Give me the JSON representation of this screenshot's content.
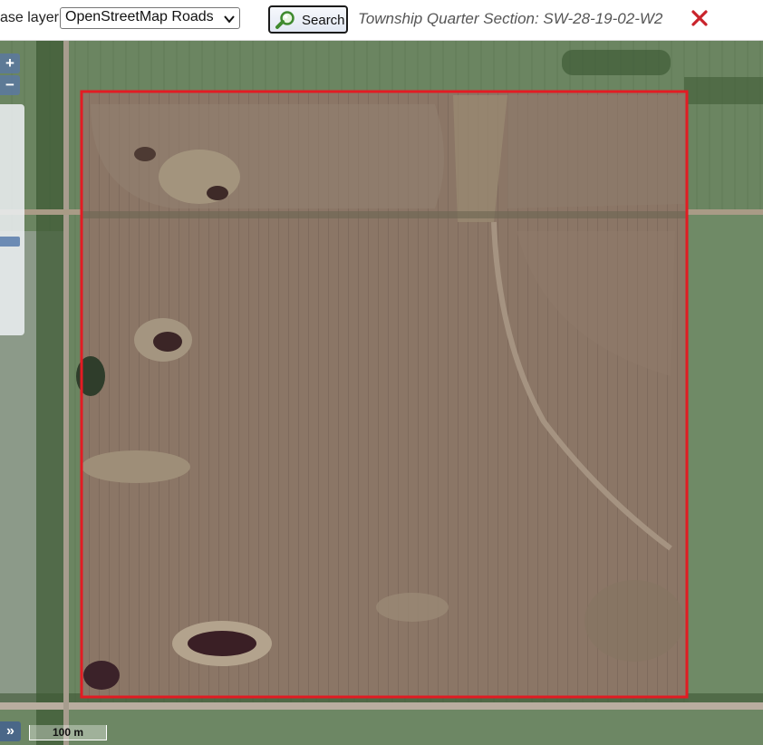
{
  "toolbar": {
    "base_layer_label": "ase layer:",
    "base_layer_selected": "OpenStreetMap Roads",
    "search_label": "Search",
    "section_title": "Township Quarter Section: SW-28-19-02-W2",
    "close_icon": "close-icon"
  },
  "map": {
    "zoom_in_label": "+",
    "zoom_out_label": "−",
    "expand_label": "»",
    "scale_label": "100 m",
    "boundary_color": "#e31b23",
    "field_color": "#8b7666",
    "vegetation_color": "#5d7a55"
  }
}
